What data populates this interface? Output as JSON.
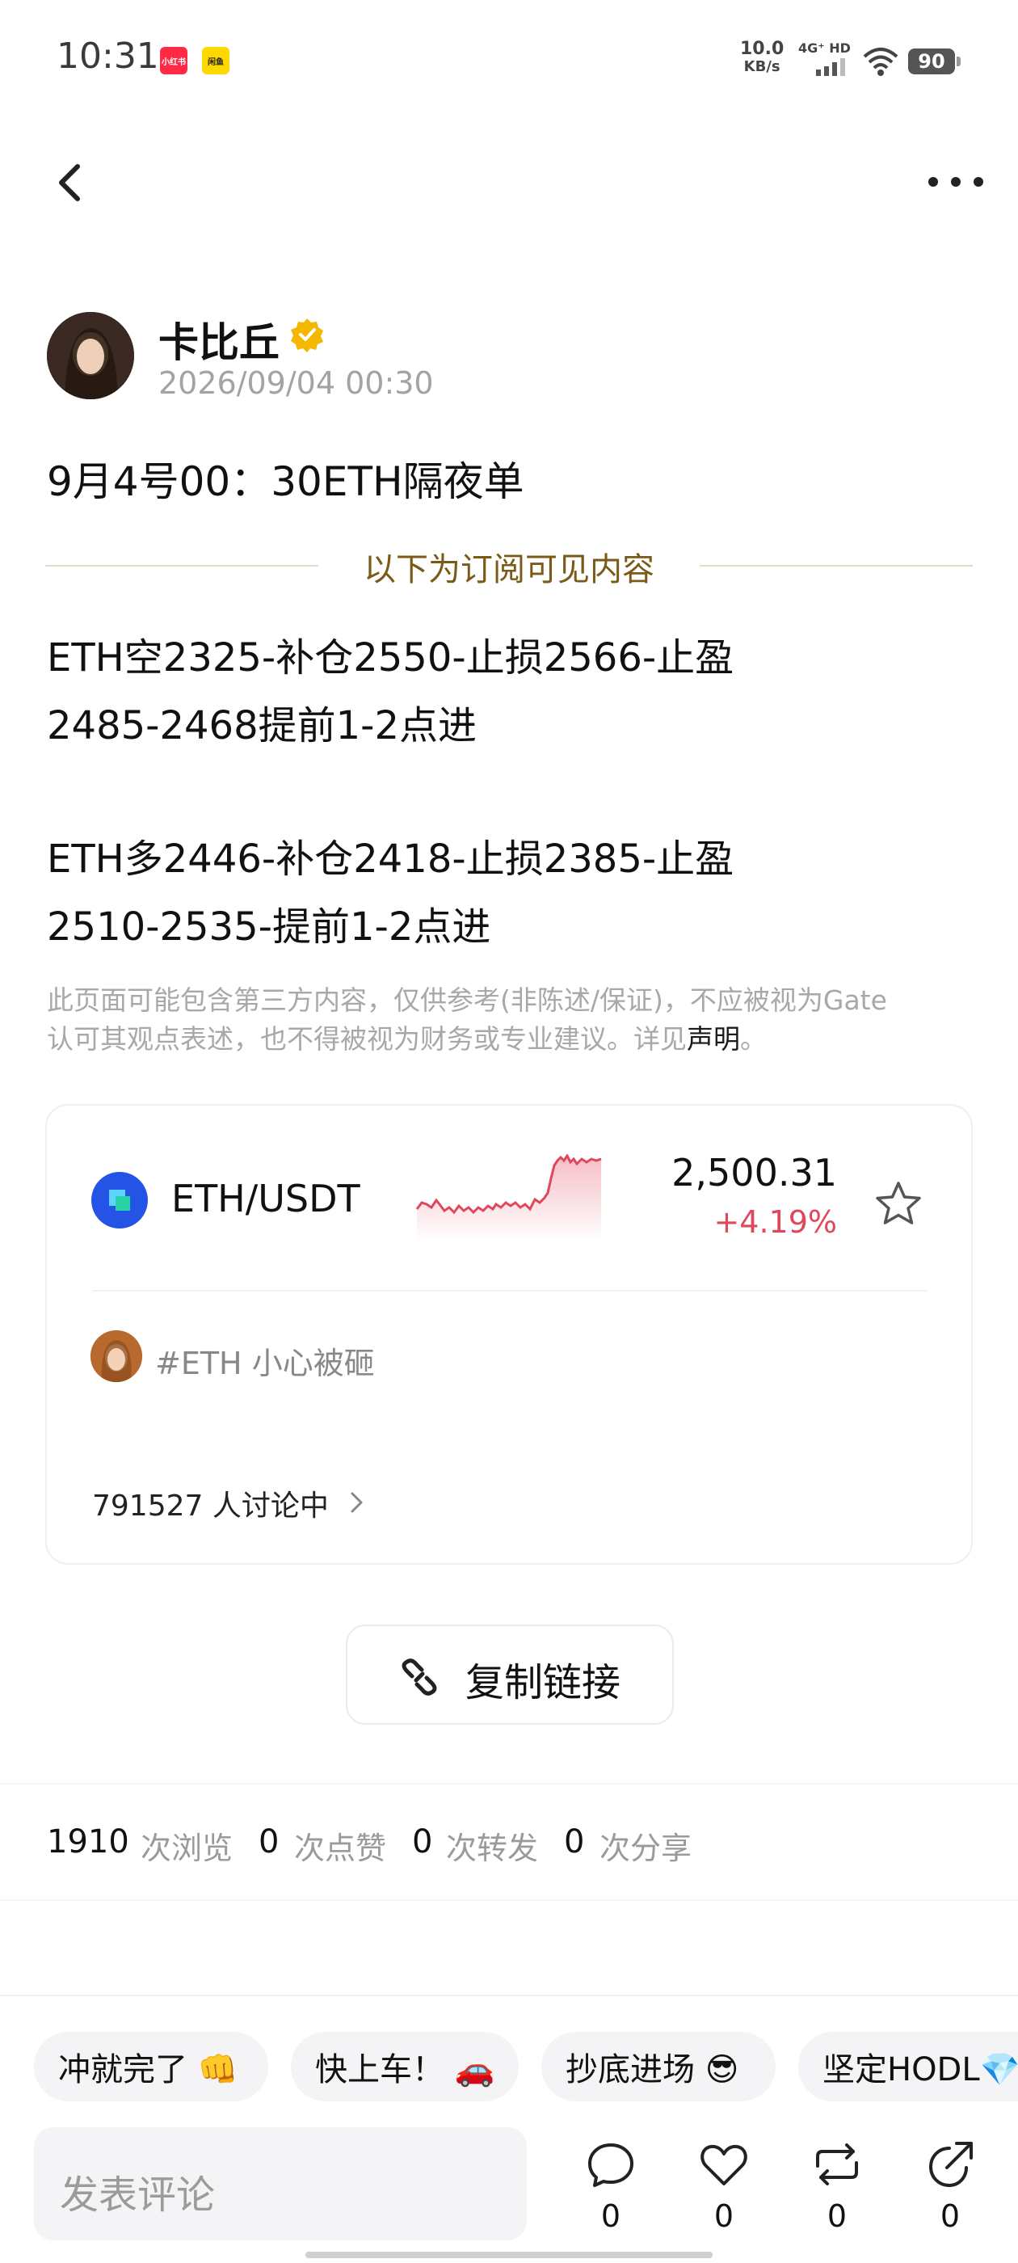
{
  "status_bar": {
    "time": "10:31",
    "app_badge_1": "小红书",
    "app_badge_2": "闲鱼",
    "net_speed_value": "10.0",
    "net_speed_unit": "KB/s",
    "network_label": "4G⁺ HD",
    "battery": "90"
  },
  "nav": {
    "back_icon": "chevron-left-icon",
    "more_icon": "more-horizontal-icon"
  },
  "author": {
    "name": "卡比丘",
    "verified_icon": "verified-badge-icon",
    "date": "2026/09/04 00:30"
  },
  "post": {
    "title": "9月4号00：30ETH隔夜单",
    "subscriber_divider": "以下为订阅可见内容",
    "line1": "ETH空2325-补仓2550-止损2566-止盈",
    "line2": "2485-2468提前1-2点进",
    "line3": "ETH多2446-补仓2418-止损2385-止盈",
    "line4": "2510-2535-提前1-2点进",
    "disclaimer_line1": "此页面可能包含第三方内容，仅供参考(非陈述/保证)，不应被视为Gate",
    "disclaimer_line2_prefix": "认可其观点表述，也不得被视为财务或专业建议。详见",
    "disclaimer_link": "声明",
    "disclaimer_end": "。"
  },
  "market_card": {
    "pair": "ETH/USDT",
    "price": "2,500.31",
    "change": "+4.19%",
    "up_color": "#e0475a",
    "star_icon": "star-outline-icon",
    "topic": "#ETH 小心被砸",
    "discussion": "791527 人讨论中"
  },
  "copy_link": {
    "label": "复制链接",
    "icon": "link-icon"
  },
  "stats": [
    {
      "value": "1910",
      "label": "次浏览"
    },
    {
      "value": "0",
      "label": "次点赞"
    },
    {
      "value": "0",
      "label": "次转发"
    },
    {
      "value": "0",
      "label": "次分享"
    }
  ],
  "quick_replies": [
    "冲就完了 👊",
    "快上车！ 🚗",
    "抄底进场 😎",
    "坚定HODL💎"
  ],
  "comment": {
    "placeholder": "发表评论",
    "actions": [
      {
        "icon": "comment-icon",
        "count": "0"
      },
      {
        "icon": "heart-icon",
        "count": "0"
      },
      {
        "icon": "repost-icon",
        "count": "0"
      },
      {
        "icon": "share-icon",
        "count": "0"
      }
    ]
  }
}
